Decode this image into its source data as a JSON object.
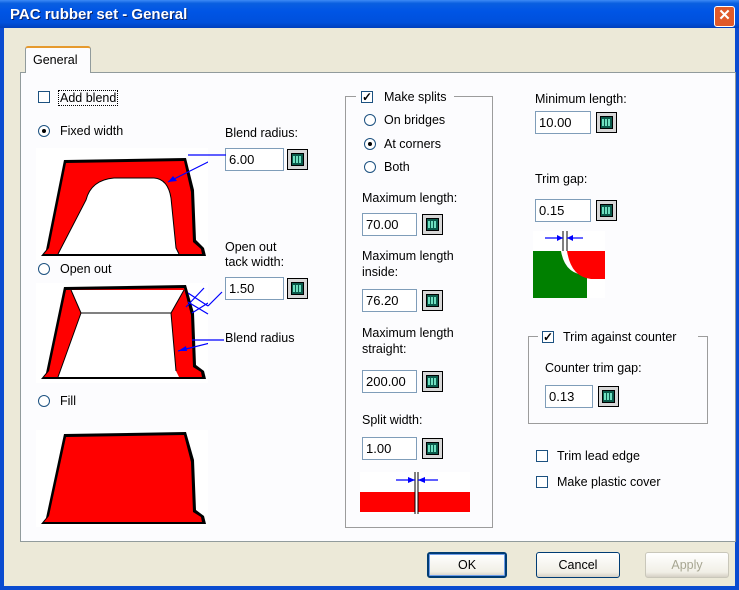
{
  "window": {
    "title": "PAC rubber set - General",
    "close_glyph": "✕"
  },
  "tabs": [
    {
      "label": "General"
    }
  ],
  "left": {
    "add_blend": {
      "label": "Add blend",
      "checked": false
    },
    "fixed_width": {
      "label": "Fixed width",
      "selected": true
    },
    "blend_radius": {
      "label": "Blend radius:",
      "value": "6.00"
    },
    "open_out": {
      "label": "Open out",
      "selected": false
    },
    "open_out_tack_width": {
      "label_line1": "Open out",
      "label_line2": "tack width:",
      "value": "1.50"
    },
    "blend_radius_annotation": "Blend radius",
    "fill": {
      "label": "Fill",
      "selected": false
    }
  },
  "splits": {
    "make_splits": {
      "label": "Make splits",
      "checked": true
    },
    "on_bridges": {
      "label": "On bridges",
      "selected": false
    },
    "at_corners": {
      "label": "At corners",
      "selected": true
    },
    "both": {
      "label": "Both",
      "selected": false
    },
    "max_length": {
      "label": "Maximum length:",
      "value": "70.00"
    },
    "max_length_inside": {
      "label_line1": "Maximum length",
      "label_line2": "inside:",
      "value": "76.20"
    },
    "max_length_straight": {
      "label_line1": "Maximum length",
      "label_line2": "straight:",
      "value": "200.00"
    },
    "split_width": {
      "label": "Split width:",
      "value": "1.00"
    }
  },
  "right": {
    "min_length": {
      "label": "Minimum length:",
      "value": "10.00"
    },
    "trim_gap": {
      "label": "Trim gap:",
      "value": "0.15"
    },
    "trim_against_counter": {
      "label": "Trim against counter",
      "checked": true
    },
    "counter_trim_gap": {
      "label": "Counter trim gap:",
      "value": "0.13"
    },
    "trim_lead_edge": {
      "label": "Trim lead edge",
      "checked": false
    },
    "make_plastic_cover": {
      "label": "Make plastic cover",
      "checked": false
    }
  },
  "buttons": {
    "ok": "OK",
    "cancel": "Cancel",
    "apply": "Apply"
  },
  "colors": {
    "rubber_red": "#ff0000",
    "counter_green": "#008000",
    "arrow_blue": "#0000ff",
    "titlebar_blue": "#0055e5"
  }
}
